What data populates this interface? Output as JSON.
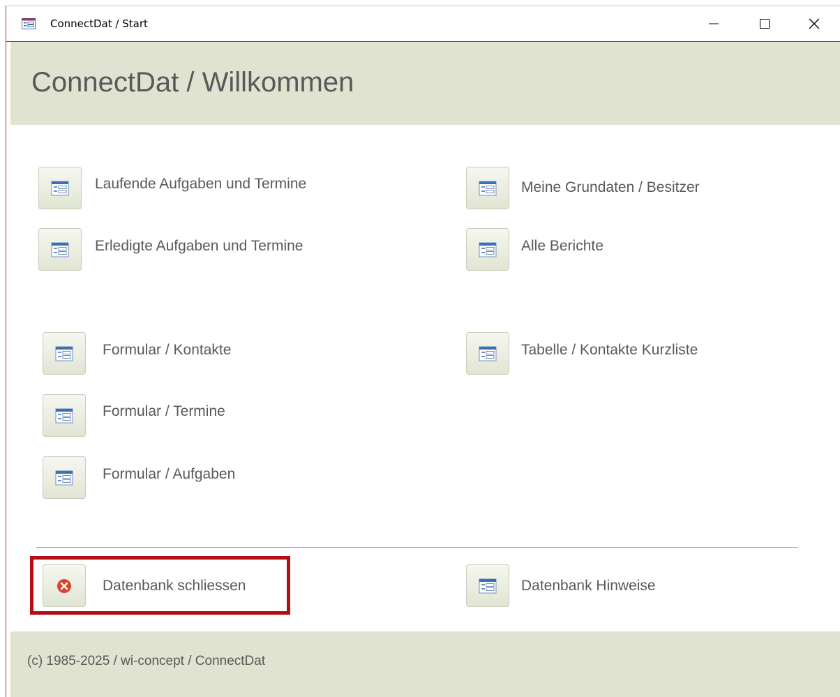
{
  "window": {
    "title": "ConnectDat / Start",
    "icon": "form-icon",
    "controls": [
      "minimize-icon",
      "maximize-icon",
      "close-icon"
    ]
  },
  "header": {
    "title": "ConnectDat / Willkommen"
  },
  "buttons": {
    "laufende": "Laufende Aufgaben und Termine",
    "erledigte": "Erledigte Aufgaben und Termine",
    "grunddaten": "Meine Grundaten / Besitzer",
    "berichte": "Alle Berichte",
    "kontakte": "Formular / Kontakte",
    "termine": "Formular / Termine",
    "aufgaben": "Formular / Aufgaben",
    "kurzliste": "Tabelle / Kontakte Kurzliste",
    "schliessen": "Datenbank schliessen",
    "hinweise": "Datenbank Hinweise"
  },
  "footer": {
    "text": "(c) 1985-2025 / wi-concept / ConnectDat"
  },
  "colors": {
    "band": "#dfe3cf",
    "text": "#595959",
    "highlight": "#b50d16",
    "close_icon": "#d9432f",
    "form_icon_blue": "#3d6fb5"
  }
}
